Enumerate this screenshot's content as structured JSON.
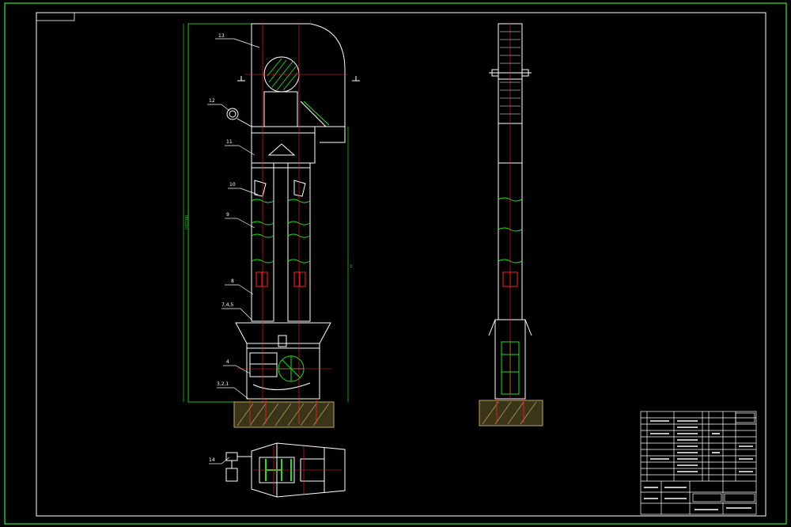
{
  "colors": {
    "background": "#000000",
    "frame": "#2ee82e",
    "outline": "#ffffff",
    "centerline": "#ff2020",
    "accent_green": "#22e022",
    "dimension": "#22c022",
    "hatch": "#b8a868",
    "table": "#ffffff"
  },
  "drawing": {
    "part_numbers": [
      "13",
      "12",
      "11",
      "10",
      "9",
      "8",
      "7,4,5",
      "4",
      "3,2,1",
      "14"
    ],
    "dimension_height": "H",
    "dimension_total": "HTOTAL"
  }
}
